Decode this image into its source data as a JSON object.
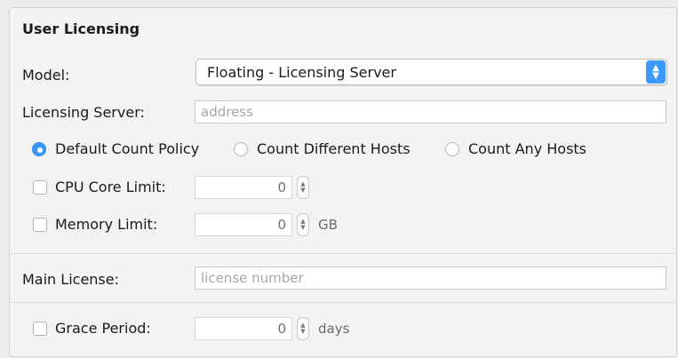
{
  "section": {
    "title": "User Licensing"
  },
  "model": {
    "label": "Model:",
    "selected": "Floating - Licensing Server"
  },
  "licensing_server": {
    "label": "Licensing Server:",
    "placeholder": "address",
    "value": ""
  },
  "count_policy": {
    "options": [
      {
        "label": "Default Count Policy",
        "checked": true
      },
      {
        "label": "Count Different Hosts",
        "checked": false
      },
      {
        "label": "Count Any Hosts",
        "checked": false
      }
    ]
  },
  "cpu_core_limit": {
    "label": "CPU Core Limit:",
    "value": "0",
    "checked": false
  },
  "memory_limit": {
    "label": "Memory Limit:",
    "value": "0",
    "unit": "GB",
    "checked": false
  },
  "main_license": {
    "label": "Main License:",
    "placeholder": "license number",
    "value": ""
  },
  "grace_period": {
    "label": "Grace Period:",
    "value": "0",
    "unit": "days",
    "checked": false
  },
  "colors": {
    "accent": "#3b99fc",
    "panel": "#f3f3f3"
  }
}
